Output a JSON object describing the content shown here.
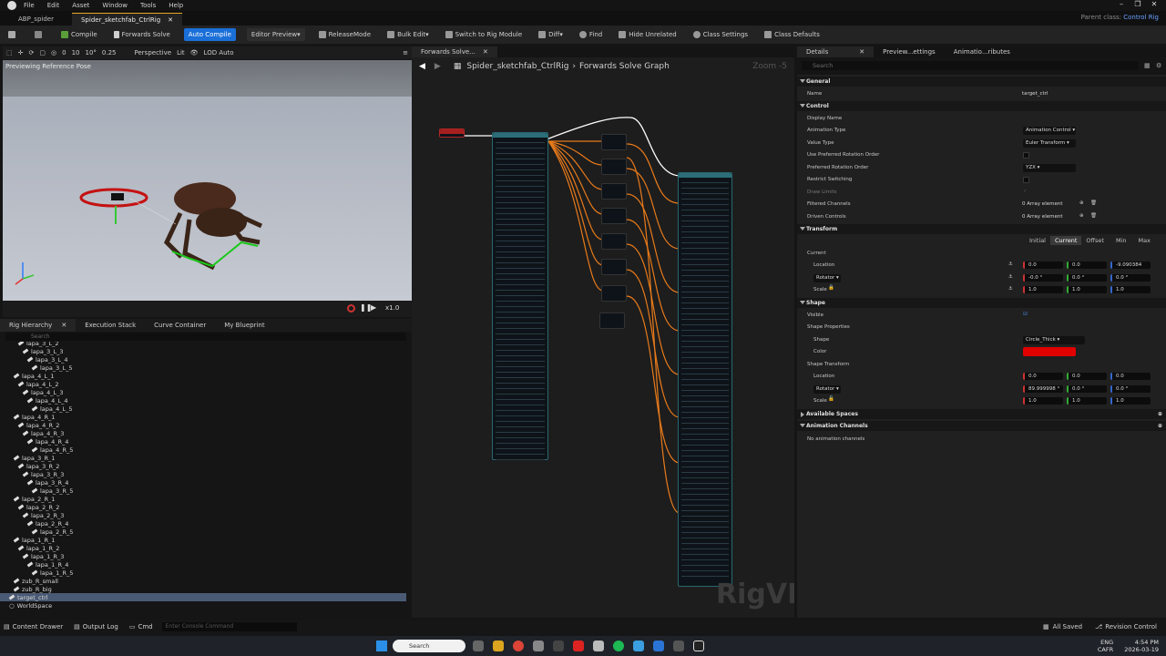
{
  "menu": {
    "items": [
      "File",
      "Edit",
      "Asset",
      "Window",
      "Tools",
      "Help"
    ]
  },
  "tabs": [
    {
      "label": "ABP_spider"
    },
    {
      "label": "Spider_sketchfab_CtrlRig"
    }
  ],
  "parent_class": {
    "label": "Parent class:",
    "value": "Control Rig"
  },
  "toolbar": {
    "compile": "Compile",
    "forwards_solve": "Forwards Solve",
    "auto_compile": "Auto Compile",
    "editor_preview": "Editor Preview",
    "release_mode": "ReleaseMode",
    "bulk_edit": "Bulk Edit",
    "switch_rig": "Switch to Rig Module",
    "diff": "Diff",
    "find": "Find",
    "hide_unrelated": "Hide Unrelated",
    "class_settings": "Class Settings",
    "class_defaults": "Class Defaults"
  },
  "viewport": {
    "perspective": "Perspective",
    "lit": "Lit",
    "lod": "LOD Auto",
    "snap_move": "10",
    "snap_rot": "10°",
    "snap_scale": "0.25",
    "rot_snap": "0",
    "overlay": "Previewing Reference Pose",
    "speed": "x1.0"
  },
  "hierarchy": {
    "tabs": [
      "Rig Hierarchy",
      "Execution Stack",
      "Curve Container",
      "My Blueprint"
    ],
    "search_placeholder": "Search",
    "items": [
      {
        "label": "lapa_3_L_2",
        "depth": 2
      },
      {
        "label": "lapa_3_L_3",
        "depth": 3
      },
      {
        "label": "lapa_3_L_4",
        "depth": 4
      },
      {
        "label": "lapa_3_L_5",
        "depth": 5
      },
      {
        "label": "lapa_4_L_1",
        "depth": 1
      },
      {
        "label": "lapa_4_L_2",
        "depth": 2
      },
      {
        "label": "lapa_4_L_3",
        "depth": 3
      },
      {
        "label": "lapa_4_L_4",
        "depth": 4
      },
      {
        "label": "lapa_4_L_5",
        "depth": 5
      },
      {
        "label": "lapa_4_R_1",
        "depth": 1
      },
      {
        "label": "lapa_4_R_2",
        "depth": 2
      },
      {
        "label": "lapa_4_R_3",
        "depth": 3
      },
      {
        "label": "lapa_4_R_4",
        "depth": 4
      },
      {
        "label": "lapa_4_R_5",
        "depth": 5
      },
      {
        "label": "lapa_3_R_1",
        "depth": 1
      },
      {
        "label": "lapa_3_R_2",
        "depth": 2
      },
      {
        "label": "lapa_3_R_3",
        "depth": 3
      },
      {
        "label": "lapa_3_R_4",
        "depth": 4
      },
      {
        "label": "lapa_3_R_5",
        "depth": 5
      },
      {
        "label": "lapa_2_R_1",
        "depth": 1
      },
      {
        "label": "lapa_2_R_2",
        "depth": 2
      },
      {
        "label": "lapa_2_R_3",
        "depth": 3
      },
      {
        "label": "lapa_2_R_4",
        "depth": 4
      },
      {
        "label": "lapa_2_R_5",
        "depth": 5
      },
      {
        "label": "lapa_1_R_1",
        "depth": 1
      },
      {
        "label": "lapa_1_R_2",
        "depth": 2
      },
      {
        "label": "lapa_1_R_3",
        "depth": 3
      },
      {
        "label": "lapa_1_R_4",
        "depth": 4
      },
      {
        "label": "lapa_1_R_5",
        "depth": 5
      },
      {
        "label": "zub_R_small",
        "depth": 1
      },
      {
        "label": "zub_R_big",
        "depth": 1
      },
      {
        "label": "target_ctrl",
        "depth": 0,
        "selected": true
      },
      {
        "label": "WorldSpace",
        "depth": 0
      }
    ]
  },
  "graph": {
    "tab": "Forwards Solve...",
    "breadcrumb_root": "Spider_sketchfab_CtrlRig",
    "breadcrumb_graph": "Forwards Solve Graph",
    "zoom": "Zoom -5",
    "watermark": "RigVM"
  },
  "details": {
    "tabs": [
      "Details",
      "Preview...ettings",
      "Animatio...ributes"
    ],
    "search_placeholder": "Search",
    "general_header": "General",
    "name_label": "Name",
    "name_value": "target_ctrl",
    "control_header": "Control",
    "display_name": "Display Name",
    "animation_type_label": "Animation Type",
    "animation_type": "Animation Control",
    "value_type_label": "Value Type",
    "value_type": "Euler Transform",
    "use_pref_rot": "Use Preferred Rotation Order",
    "pref_rot_label": "Preferred Rotation Order",
    "pref_rot": "YZX",
    "restrict_switching": "Restrict Switching",
    "draw_limits": "Draw Limits",
    "filtered_channels": "Filtered Channels",
    "filtered_value": "0 Array element",
    "driven_controls": "Driven Controls",
    "driven_value": "0 Array element",
    "transform_header": "Transform",
    "transform_tabs": [
      "Initial",
      "Current",
      "Offset",
      "Min",
      "Max"
    ],
    "current_label": "Current",
    "location_label": "Location",
    "location": [
      "0.0",
      "0.0",
      "-9.090384"
    ],
    "rotator_label": "Rotator",
    "rotation": [
      "-0.0 °",
      "0.0 °",
      "0.0 °"
    ],
    "scale_label": "Scale",
    "scale": [
      "1.0",
      "1.0",
      "1.0"
    ],
    "shape_header": "Shape",
    "visible_label": "Visible",
    "shape_props": "Shape Properties",
    "shape_label": "Shape",
    "shape_value": "Circle_Thick",
    "color_label": "Color",
    "color_hex": "#e00000",
    "shape_transform": "Shape Transform",
    "st_location": [
      "0.0",
      "0.0",
      "0.0"
    ],
    "st_rotation": [
      "89.999998 °",
      "0.0 °",
      "0.0 °"
    ],
    "st_scale": [
      "1.0",
      "1.0",
      "1.0"
    ],
    "available_spaces": "Available Spaces",
    "animation_channels": "Animation Channels",
    "no_channels": "No animation channels"
  },
  "status": {
    "content_drawer": "Content Drawer",
    "output_log": "Output Log",
    "cmd": "Cmd",
    "console_placeholder": "Enter Console Command",
    "saved": "All Saved",
    "revision": "Revision Control"
  },
  "taskbar": {
    "search": "Search",
    "lang": "ENG",
    "kb": "CAFR",
    "time": "4:54 PM",
    "date": "2026-03-19"
  }
}
